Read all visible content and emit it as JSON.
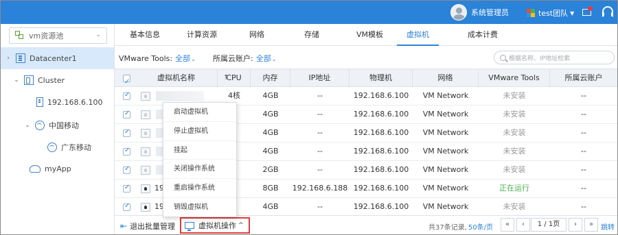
{
  "topbar": {
    "user_name": "系统管理员",
    "team_name": "test团队",
    "brand_color": "#2a82d9",
    "icons": [
      "avatar",
      "team-grid-icon",
      "mail-icon",
      "headset-icon"
    ]
  },
  "sidebar": {
    "pool_select": "vm资源池",
    "tree": [
      {
        "label": "Datacenter1",
        "icon": "datacenter-icon",
        "expanded": false,
        "selected": true
      },
      {
        "label": "Cluster",
        "icon": "cluster-icon",
        "expanded": true
      },
      {
        "label": "192.168.6.100",
        "icon": "host-icon"
      },
      {
        "label": "中国移动",
        "icon": "globe-icon",
        "expanded": true
      },
      {
        "label": "广东移动",
        "icon": "globe-icon"
      },
      {
        "label": "myApp",
        "icon": "app-icon"
      }
    ]
  },
  "tabs": [
    {
      "label": "基本信息"
    },
    {
      "label": "计算资源"
    },
    {
      "label": "网络"
    },
    {
      "label": "存储"
    },
    {
      "label": "VM模板"
    },
    {
      "label": "虚拟机",
      "active": true
    },
    {
      "label": "成本计费"
    }
  ],
  "filters": {
    "tools_label": "VMware Tools:",
    "tools_value": "全部",
    "account_label": "所属云账户:",
    "account_value": "全部",
    "search_placeholder": "根据名称、IP地址检索"
  },
  "table": {
    "columns": [
      "虚拟机名称",
      "CPU",
      "内存",
      "IP地址",
      "物理机",
      "网络",
      "VMware Tools",
      "所属云账户"
    ],
    "rows": [
      {
        "name": "",
        "cpu": "4核",
        "memory": "4GB",
        "ip": "--",
        "host": "192.168.6.100",
        "network": "VM Network",
        "tools": "未安装",
        "account": "--"
      },
      {
        "name": "",
        "cpu": "",
        "memory": "4GB",
        "ip": "--",
        "host": "192.168.6.100",
        "network": "VM Network",
        "tools": "未安装",
        "account": "--"
      },
      {
        "name": "",
        "cpu": "",
        "memory": "4GB",
        "ip": "--",
        "host": "192.168.6.100",
        "network": "VM Network",
        "tools": "未安装",
        "account": "--"
      },
      {
        "name": "",
        "cpu": "",
        "memory": "4GB",
        "ip": "--",
        "host": "192.168.6.100",
        "network": "VM Network",
        "tools": "未安装",
        "account": "--"
      },
      {
        "name": "",
        "cpu": "",
        "memory": "2GB",
        "ip": "--",
        "host": "192.168.6.100",
        "network": "VM Network",
        "tools": "未安装",
        "account": "--"
      },
      {
        "name": "19",
        "cpu": "",
        "memory": "8GB",
        "ip": "192.168.6.188",
        "host": "192.168.6.100",
        "network": "VM Network",
        "tools": "正在运行",
        "account": "--"
      },
      {
        "name": "19",
        "cpu": "",
        "memory": "4GB",
        "ip": "--",
        "host": "192.168.6.100",
        "network": "VM Network",
        "tools": "未安装",
        "account": "--"
      }
    ]
  },
  "context_menu": [
    "启动虚拟机",
    "停止虚拟机",
    "挂起",
    "关闭操作系统",
    "重启操作系统",
    "销毁虚拟机"
  ],
  "footer": {
    "exit_batch": "退出批量管理",
    "vm_ops": "虚拟机操作",
    "total": "共37条记录,",
    "per_page": "50条/页",
    "first": "«",
    "prev": "‹",
    "page_info": "1 / 1页",
    "next": "›",
    "last": "»",
    "jump": "跳转"
  }
}
